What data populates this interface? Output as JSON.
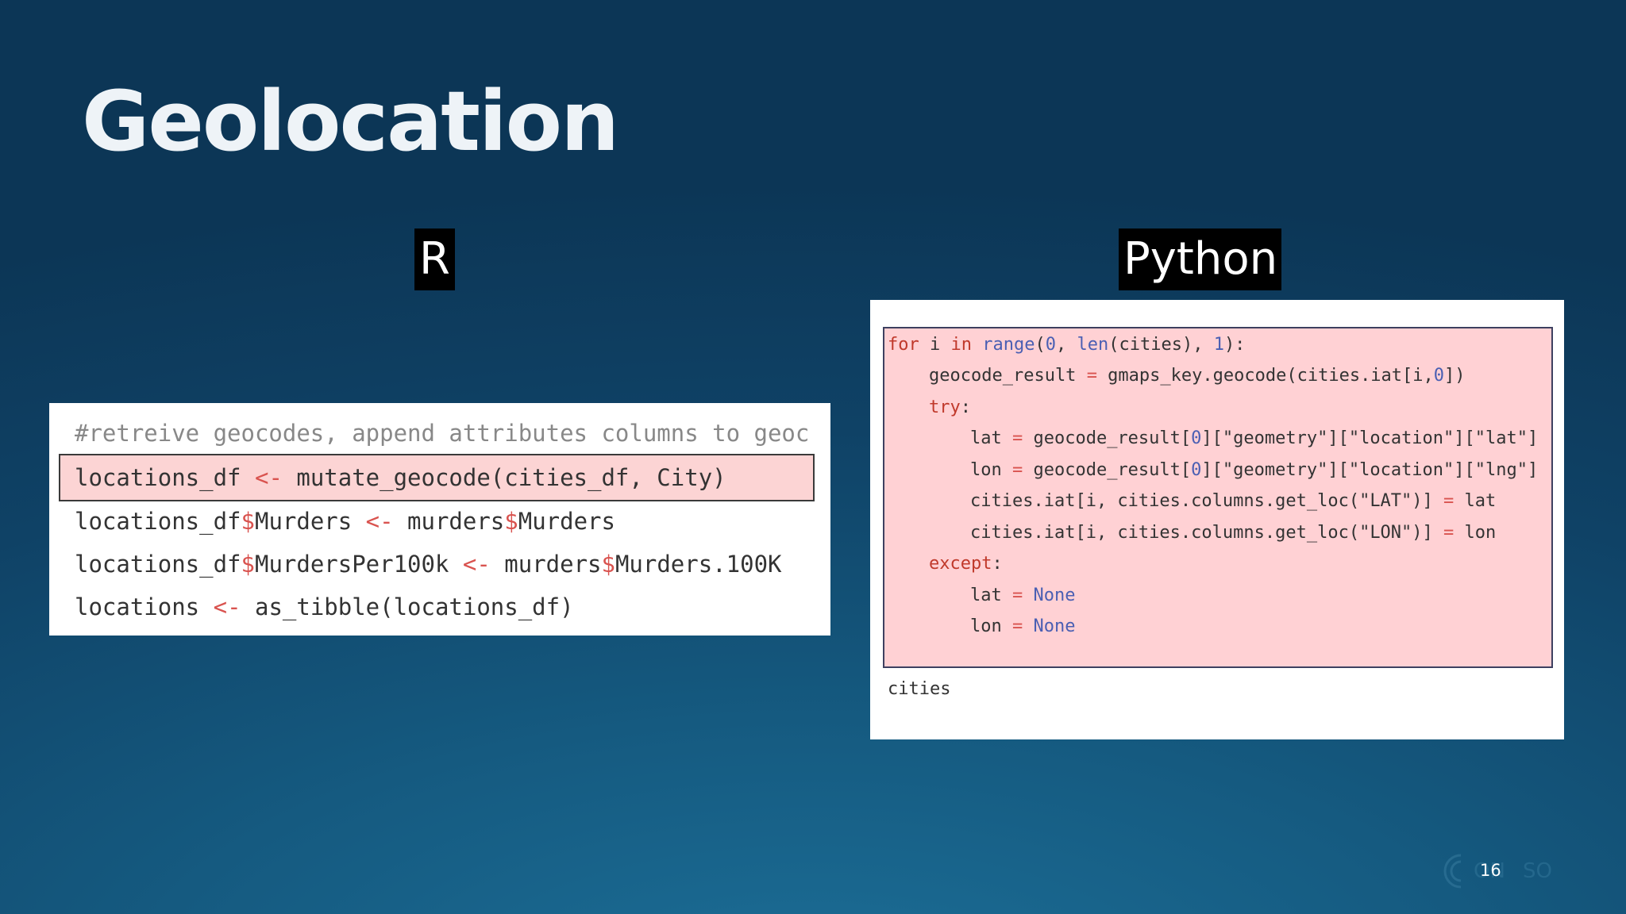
{
  "slide": {
    "title": "Geolocation",
    "page_number": "16"
  },
  "labels": {
    "r": "R",
    "python": "Python"
  },
  "r_code": {
    "comment": "#retreive geocodes, append attributes columns to geoc",
    "line1": {
      "a": "locations_df ",
      "op": "<-",
      "b": " mutate_geocode(cities_df, City)"
    },
    "line2": {
      "a": "locations_df",
      "d1": "$",
      "b": "Murders ",
      "op": "<-",
      "c": " murders",
      "d2": "$",
      "e": "Murders"
    },
    "line3": {
      "a": "locations_df",
      "d1": "$",
      "b": "MurdersPer100k ",
      "op": "<-",
      "c": " murders",
      "d2": "$",
      "e": "Murders.100K"
    },
    "line4": {
      "a": "locations ",
      "op": "<-",
      "b": " as_tibble(locations_df)"
    }
  },
  "python_code": {
    "l1": {
      "kw1": "for",
      "t1": " i ",
      "kw2": "in",
      "t2": " ",
      "bi1": "range",
      "t3": "(",
      "n1": "0",
      "t4": ", ",
      "bi2": "len",
      "t5": "(cities), ",
      "n2": "1",
      "t6": "):"
    },
    "l2": {
      "t1": "geocode_result ",
      "op": "=",
      "t2": " gmaps_key.geocode(cities.iat[i,",
      "n1": "0",
      "t3": "])"
    },
    "l3": {
      "kw": "try",
      "t": ":"
    },
    "l4": {
      "t1": "lat ",
      "op": "=",
      "t2": " geocode_result[",
      "n1": "0",
      "t3": "][\"geometry\"][\"location\"][\"lat\"]"
    },
    "l5": {
      "t1": "lon ",
      "op": "=",
      "t2": " geocode_result[",
      "n1": "0",
      "t3": "][\"geometry\"][\"location\"][\"lng\"]"
    },
    "l6": {
      "t1": "cities.iat[i, cities.columns.get_loc(\"LAT\")] ",
      "op": "=",
      "t2": " lat"
    },
    "l7": {
      "t1": "cities.iat[i, cities.columns.get_loc(\"LON\")] ",
      "op": "=",
      "t2": " lon"
    },
    "l8": {
      "kw": "except",
      "t": ":"
    },
    "l9": {
      "t1": "lat ",
      "op": "=",
      "t2": " ",
      "c": "None"
    },
    "l10": {
      "t1": "lon ",
      "op": "=",
      "t2": " ",
      "c": "None"
    },
    "after": "cities"
  },
  "colors": {
    "highlight": "#fcd4d4",
    "python_block": "#ffd1d4",
    "keyword": "#c0392b",
    "builtin": "#4a5fb3"
  }
}
